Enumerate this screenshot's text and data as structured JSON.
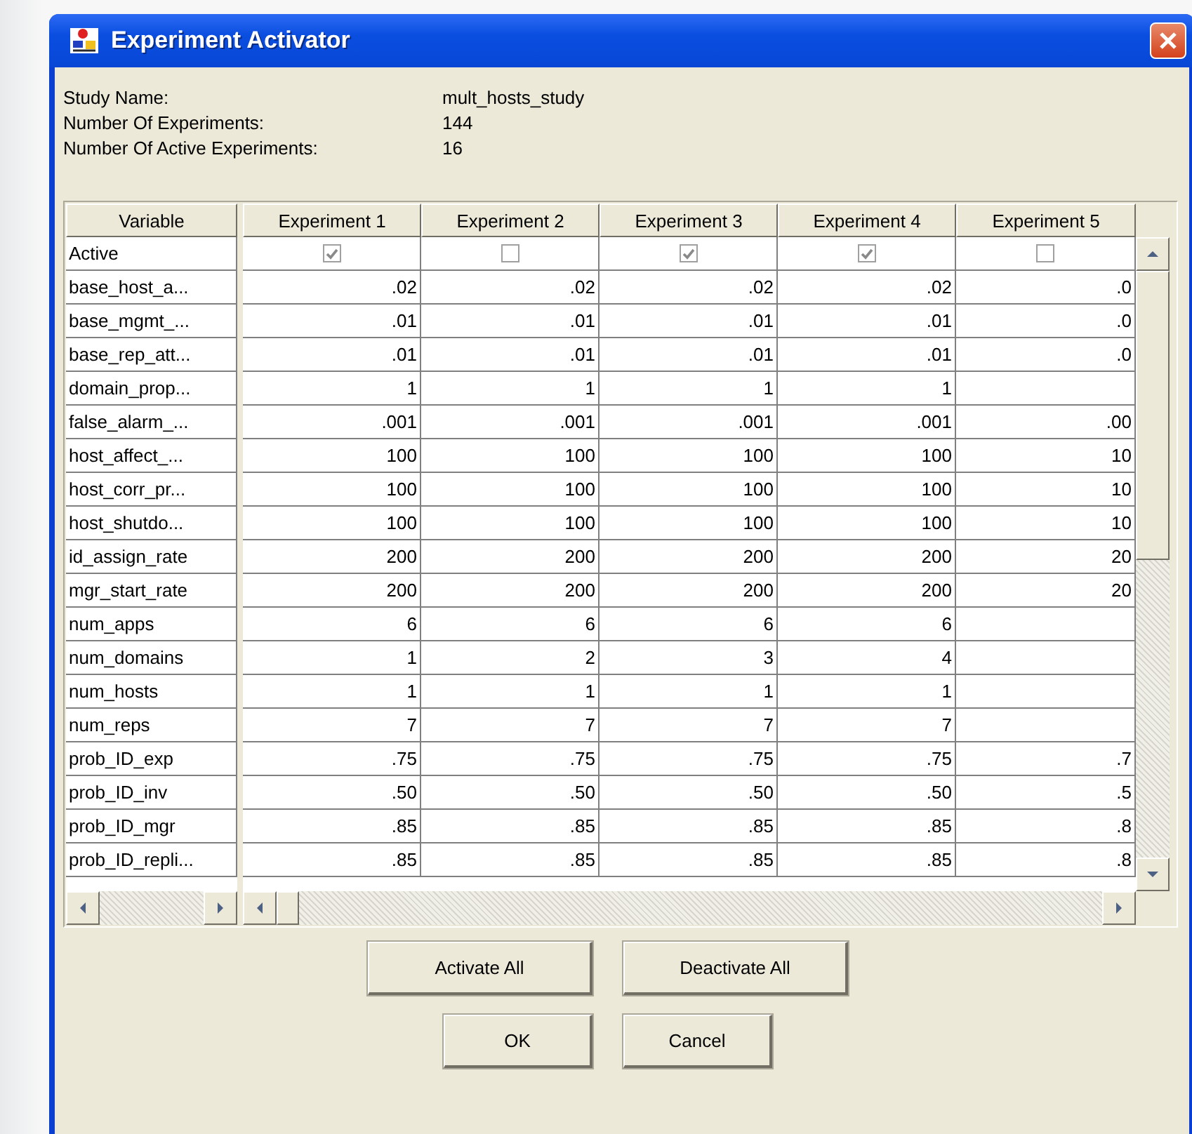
{
  "window": {
    "title": "Experiment Activator"
  },
  "info": [
    {
      "label": "Study Name:",
      "value": "mult_hosts_study"
    },
    {
      "label": "Number Of Experiments:",
      "value": "144"
    },
    {
      "label": "Number Of Active Experiments:",
      "value": "16"
    }
  ],
  "table": {
    "row_header_column": "Variable",
    "columns": [
      "Experiment 1",
      "Experiment 2",
      "Experiment 3",
      "Experiment 4",
      "Experiment 5"
    ],
    "rows": [
      {
        "kind": "checkbox",
        "variable": "Active",
        "cells": [
          {
            "checked": true
          },
          {
            "checked": false
          },
          {
            "checked": true
          },
          {
            "checked": true
          },
          {
            "checked": false
          }
        ]
      },
      {
        "kind": "value",
        "variable": "base_host_a...",
        "cells": [
          ".02",
          ".02",
          ".02",
          ".02",
          ".0"
        ]
      },
      {
        "kind": "value",
        "variable": "base_mgmt_...",
        "cells": [
          ".01",
          ".01",
          ".01",
          ".01",
          ".0"
        ]
      },
      {
        "kind": "value",
        "variable": "base_rep_att...",
        "cells": [
          ".01",
          ".01",
          ".01",
          ".01",
          ".0"
        ]
      },
      {
        "kind": "value",
        "variable": "domain_prop...",
        "cells": [
          "1",
          "1",
          "1",
          "1",
          null
        ]
      },
      {
        "kind": "value",
        "variable": "false_alarm_...",
        "cells": [
          ".001",
          ".001",
          ".001",
          ".001",
          ".00"
        ]
      },
      {
        "kind": "value",
        "variable": "host_affect_...",
        "cells": [
          "100",
          "100",
          "100",
          "100",
          "10"
        ]
      },
      {
        "kind": "value",
        "variable": "host_corr_pr...",
        "cells": [
          "100",
          "100",
          "100",
          "100",
          "10"
        ]
      },
      {
        "kind": "value",
        "variable": "host_shutdo...",
        "cells": [
          "100",
          "100",
          "100",
          "100",
          "10"
        ]
      },
      {
        "kind": "value",
        "variable": "id_assign_rate",
        "cells": [
          "200",
          "200",
          "200",
          "200",
          "20"
        ]
      },
      {
        "kind": "value",
        "variable": "mgr_start_rate",
        "cells": [
          "200",
          "200",
          "200",
          "200",
          "20"
        ]
      },
      {
        "kind": "value",
        "variable": "num_apps",
        "cells": [
          "6",
          "6",
          "6",
          "6",
          null
        ]
      },
      {
        "kind": "value",
        "variable": "num_domains",
        "cells": [
          "1",
          "2",
          "3",
          "4",
          null
        ]
      },
      {
        "kind": "value",
        "variable": "num_hosts",
        "cells": [
          "1",
          "1",
          "1",
          "1",
          null
        ]
      },
      {
        "kind": "value",
        "variable": "num_reps",
        "cells": [
          "7",
          "7",
          "7",
          "7",
          null
        ]
      },
      {
        "kind": "value",
        "variable": "prob_ID_exp",
        "cells": [
          ".75",
          ".75",
          ".75",
          ".75",
          ".7"
        ]
      },
      {
        "kind": "value",
        "variable": "prob_ID_inv",
        "cells": [
          ".50",
          ".50",
          ".50",
          ".50",
          ".5"
        ]
      },
      {
        "kind": "value",
        "variable": "prob_ID_mgr",
        "cells": [
          ".85",
          ".85",
          ".85",
          ".85",
          ".8"
        ]
      },
      {
        "kind": "value",
        "variable": "prob_ID_repli...",
        "cells": [
          ".85",
          ".85",
          ".85",
          ".85",
          ".8"
        ]
      }
    ]
  },
  "buttons": [
    [
      "Activate All",
      "Deactivate All"
    ],
    [
      "OK",
      "Cancel"
    ]
  ]
}
